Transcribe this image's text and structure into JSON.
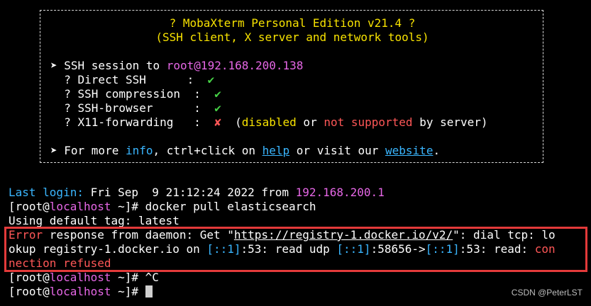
{
  "banner": {
    "title": "? MobaXterm Personal Edition v21.4 ?",
    "subtitle": "(SSH client, X server and network tools)",
    "ssh_prefix": "➤ SSH session to ",
    "ssh_host": "root@192.168.200.138",
    "features": [
      {
        "label": "  ? Direct SSH      :  ",
        "mark": "✔"
      },
      {
        "label": "  ? SSH compression  :  ",
        "mark": "✔"
      },
      {
        "label": "  ? SSH-browser      :  ",
        "mark": "✔"
      },
      {
        "label": "  ? X11-forwarding   :  ",
        "mark": "✘"
      }
    ],
    "x11_note_open": "  (",
    "x11_disabled": "disabled",
    "x11_or": " or ",
    "x11_not_supported": "not supported",
    "x11_by_server": " by server)",
    "more_prefix": "➤ For more ",
    "info": "info",
    "more_mid": ", ctrl+click on ",
    "help": "help",
    "more_mid2": " or visit our ",
    "website": "website",
    "more_end": "."
  },
  "terminal": {
    "last_login_label": "Last login:",
    "last_login_time": " Fri Sep  9 21:12:24 2022 from ",
    "last_login_ip": "192.168.200.1",
    "prompt_open": "[root@",
    "prompt_host": "localhost",
    "prompt_close": " ~]# ",
    "cmd1": "docker pull elasticsearch",
    "default_tag": "Using default tag: latest",
    "err_word": "Error",
    "err_1a": " response from daemon: Get \"",
    "err_url": "https://registry-1.docker.io/v2/",
    "err_1b": "\": dial tcp: lo",
    "err_2a": "okup registry-1.docker.io on ",
    "err_ip1": "[::1]",
    "err_2b": ":53: read udp ",
    "err_ip2": "[::1]",
    "err_2c": ":58656->",
    "err_ip3": "[::1]",
    "err_2d": ":53: read: ",
    "err_con": "con",
    "err_3": "nection refused",
    "cmd2": "^C"
  },
  "watermark": "CSDN @PeterLST"
}
